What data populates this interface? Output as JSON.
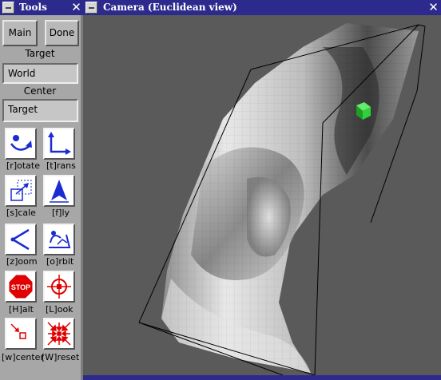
{
  "tools_window": {
    "title": "Tools",
    "buttons": {
      "main": "Main",
      "done": "Done"
    },
    "target_label": "Target",
    "target_value": "World",
    "center_label": "Center",
    "center_value": "Target",
    "modes": [
      {
        "label": "[r]otate"
      },
      {
        "label": "[t]rans"
      },
      {
        "label": "[s]cale"
      },
      {
        "label": "[f]ly"
      },
      {
        "label": "[z]oom"
      },
      {
        "label": "[o]rbit"
      },
      {
        "label": "[H]alt"
      },
      {
        "label": "[L]ook"
      },
      {
        "label": "[w]center"
      },
      {
        "label": "[W]reset"
      }
    ],
    "stop_text": "STOP"
  },
  "camera_window": {
    "title": "Camera (Euclidean view)"
  },
  "colors": {
    "title_bar": "#2c2a8c",
    "icon_blue": "#1a2bd0",
    "icon_red": "#e00000",
    "marker_green": "#2fd13a",
    "viewport_bg": "#5a5a5a",
    "panel_bg": "#a7a7a7"
  }
}
